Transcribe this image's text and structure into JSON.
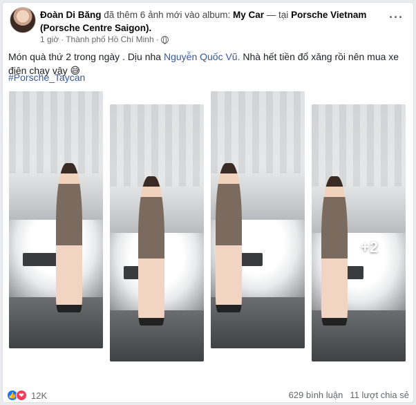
{
  "post": {
    "author": "Đoàn Di Băng",
    "action": "đã thêm 6 ảnh mới vào album:",
    "album": "My Car",
    "separator": "— tại",
    "location_name": "Porsche Vietnam",
    "location_sub": "(Porsche Centre Saigon).",
    "time": "1 giờ",
    "place": "Thành phố Hồ Chí Minh",
    "dot": "·",
    "more_label": "···",
    "text_before": "Món quà thứ 2 trong ngày . Dịu nha ",
    "mention": "Nguyễn Quốc Vũ.",
    "text_after": "  Nhà hết tiền đổ xăng rồi nên mua xe điện chạy vậy 😅",
    "hashtag": "#Porsche_Taycan",
    "more_photos": "+2"
  },
  "footer": {
    "reaction_count": "12K",
    "comments": "629 bình luận",
    "shares": "11 lượt chia sẻ"
  },
  "icons": {
    "like": "like-icon",
    "love": "love-icon",
    "globe": "globe-icon"
  },
  "colors": {
    "link": "#385898",
    "like": "#1877f2",
    "love": "#f33e58"
  }
}
